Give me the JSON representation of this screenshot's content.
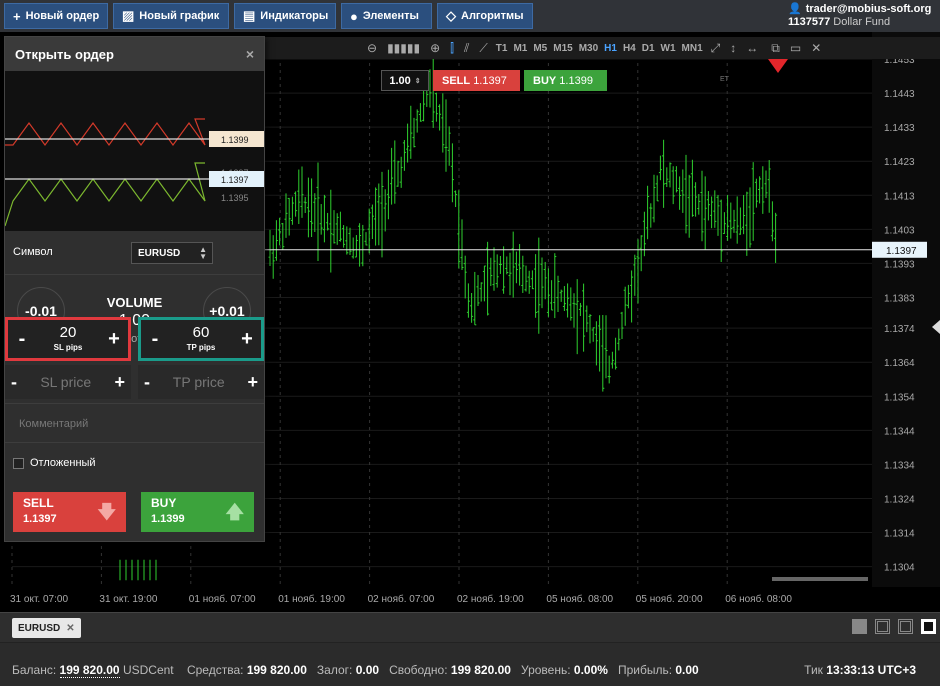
{
  "toolbar": {
    "new_order": "Новый ордер",
    "new_chart": "Новый график",
    "indicators": "Индикаторы",
    "elements": "Элементы",
    "algorithms": "Алгоритмы"
  },
  "account": {
    "user": "trader@mobius-soft.org",
    "number": "1137577",
    "fund": "Dollar Fund"
  },
  "timeframes": [
    "T1",
    "M1",
    "M5",
    "M15",
    "M30",
    "H1",
    "H4",
    "D1",
    "W1",
    "MN1"
  ],
  "active_timeframe": "H1",
  "quote": {
    "volume": "1.00",
    "sell_label": "SELL",
    "sell_price": "1.1397",
    "buy_label": "BUY",
    "buy_price": "1.1399",
    "server_time_label": "ET"
  },
  "chart_data": {
    "type": "ohlc",
    "symbol": "EURUSD",
    "x_tick_labels": [
      "31 окт. 07:00",
      "31 окт. 19:00",
      "01 нояб. 07:00",
      "01 нояб. 19:00",
      "02 нояб. 07:00",
      "02 нояб. 19:00",
      "05 нояб. 08:00",
      "05 нояб. 20:00",
      "06 нояб. 08:00"
    ],
    "y_tick_labels": [
      "1.1453",
      "1.1443",
      "1.1433",
      "1.1423",
      "1.1413",
      "1.1403",
      "1.1393",
      "1.1383",
      "1.1374",
      "1.1364",
      "1.1354",
      "1.1344",
      "1.1334",
      "1.1324",
      "1.1314",
      "1.1304"
    ],
    "ylim": [
      1.1298,
      1.1458
    ],
    "current_price": "1.1397",
    "current_price_value": 1.1397,
    "color": "#2fd12f",
    "grid": true
  },
  "panel": {
    "title": "Открыть ордер",
    "mini_prices": [
      "1.1399",
      "1.1397",
      "1.1395"
    ],
    "mini_buy": "1.1399",
    "mini_sell": "1.1397",
    "symbol_label": "Символ",
    "symbol_value": "EURUSD",
    "vol_minus": "-0.01",
    "vol_plus": "+0.01",
    "vol_title": "VOLUME",
    "vol_value": "1.00",
    "vol_unit": "lot",
    "sl_value": "20",
    "sl_label": "SL pips",
    "tp_value": "60",
    "tp_label": "TP pips",
    "sl_price_placeholder": "SL price",
    "tp_price_placeholder": "TP price",
    "comment_placeholder": "Комментарий",
    "pending_label": "Отложенный",
    "sell_label": "SELL",
    "sell_price": "1.1397",
    "buy_label": "BUY",
    "buy_price": "1.1399"
  },
  "tabs": {
    "symbol": "EURUSD"
  },
  "status": {
    "balance_label": "Баланс:",
    "balance_value": "199 820.00",
    "balance_ccy": "USDCent",
    "funds_label": "Средства:",
    "funds_value": "199 820.00",
    "margin_label": "Залог:",
    "margin_value": "0.00",
    "free_label": "Свободно:",
    "free_value": "199 820.00",
    "level_label": "Уровень:",
    "level_value": "0.00%",
    "profit_label": "Прибыль:",
    "profit_value": "0.00",
    "tick_label": "Тик",
    "tick_value": "13:33:13",
    "tz": "UTC+3"
  }
}
